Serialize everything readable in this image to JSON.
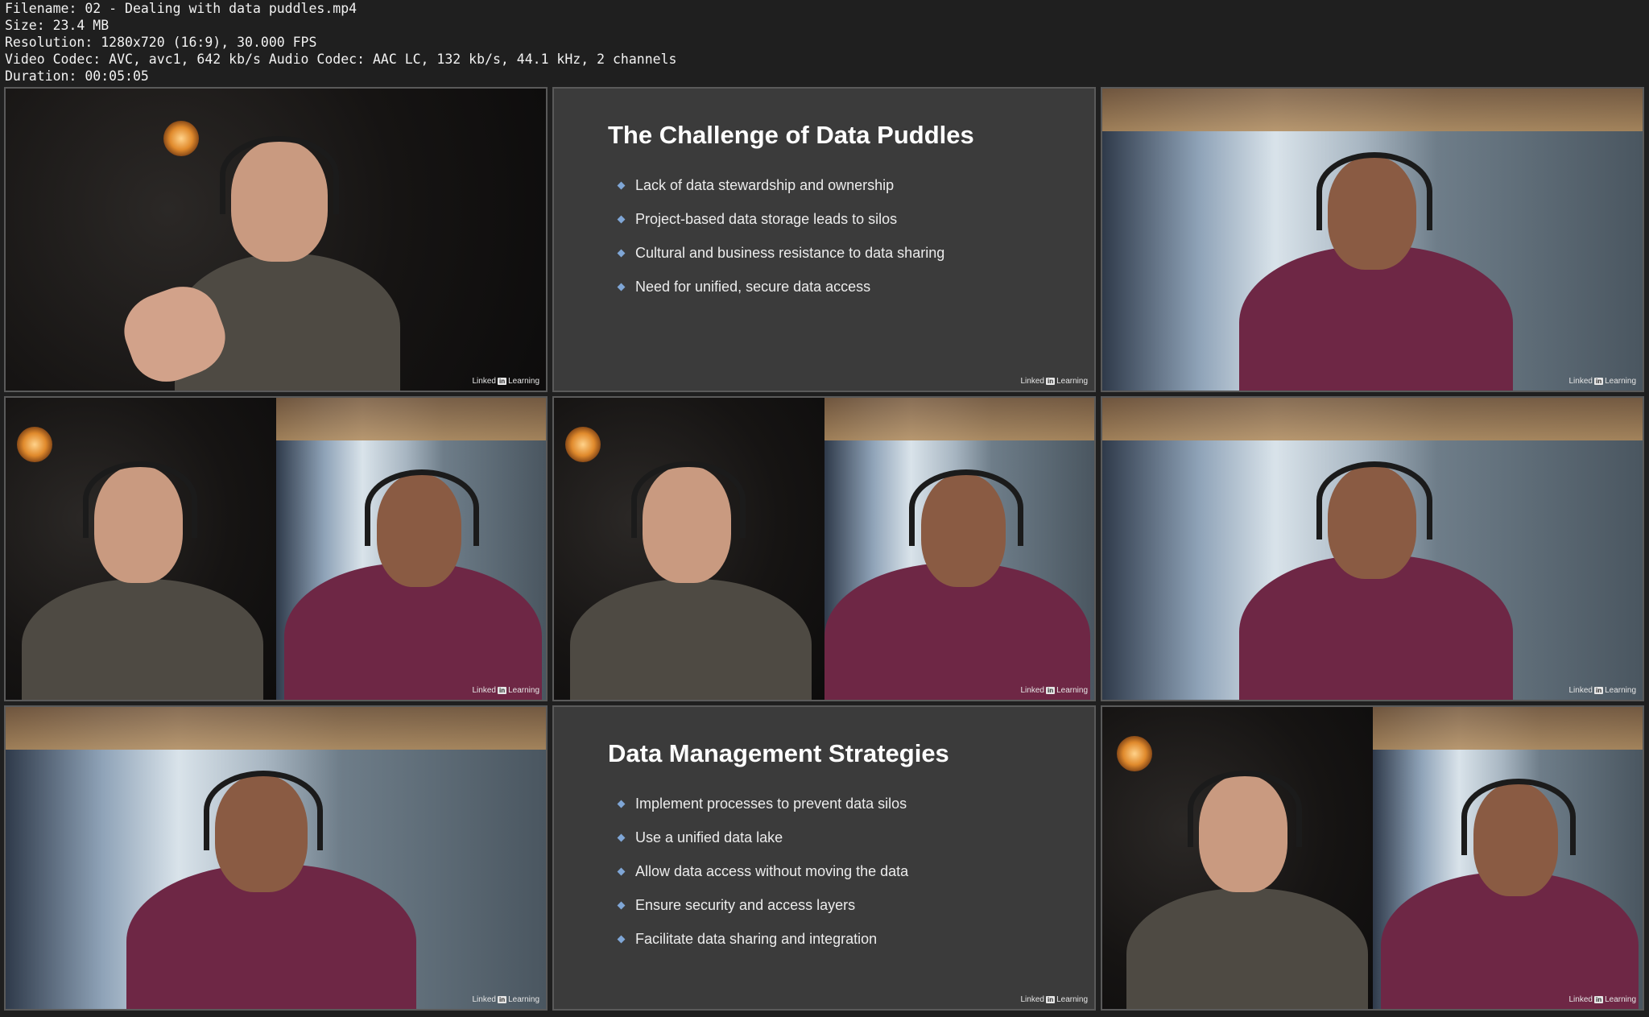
{
  "file_info": {
    "filename_line": "Filename: 02 - Dealing with data puddles.mp4",
    "size_line": "Size: 23.4 MB",
    "resolution_line": "Resolution: 1280x720 (16:9), 30.000 FPS",
    "codec_line": "Video Codec: AVC, avc1, 642 kb/s Audio Codec: AAC LC, 132 kb/s, 44.1 kHz, 2 channels",
    "duration_line": "Duration: 00:05:05"
  },
  "watermark": {
    "pre": "Linked",
    "in": "in",
    "post": "Learning"
  },
  "slides": [
    {
      "title": "The Challenge of Data Puddles",
      "bullets": [
        "Lack of data stewardship and ownership",
        "Project-based data storage leads to silos",
        "Cultural and business resistance to data sharing",
        "Need for unified, secure data access"
      ]
    },
    {
      "title": "Data Management Strategies",
      "bullets": [
        "Implement processes to prevent data silos",
        "Use a unified data lake",
        "Allow data access without moving the data",
        "Ensure security and access layers",
        "Facilitate data sharing and integration"
      ]
    }
  ],
  "colors": {
    "slide_bg": "#3b3b3b",
    "bullet": "#7fa6d6",
    "shirt": "#6e2745",
    "hoodie": "#4e4a43"
  }
}
